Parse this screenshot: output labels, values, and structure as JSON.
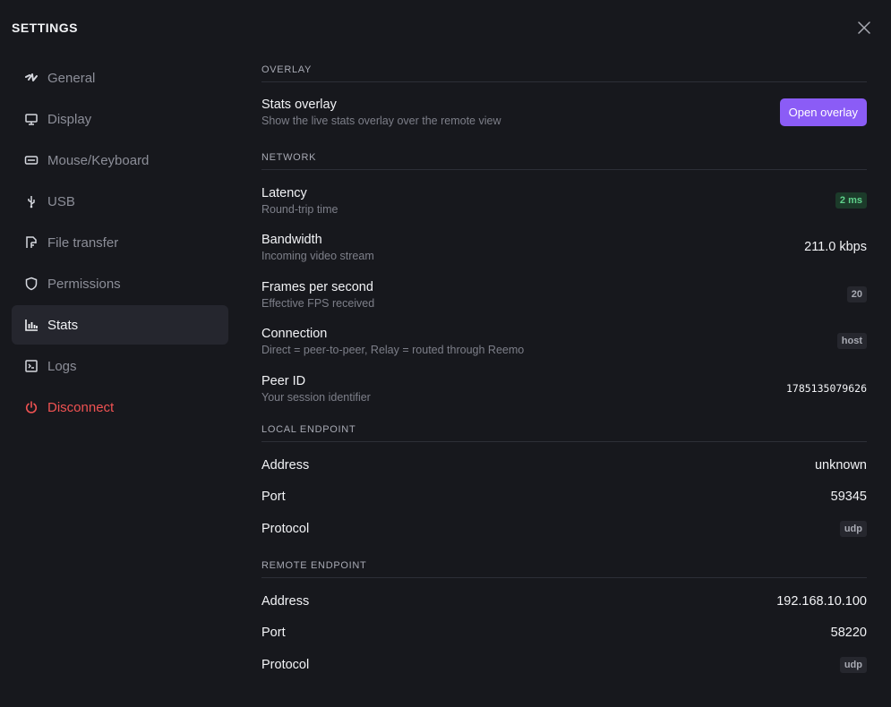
{
  "header": {
    "title": "SETTINGS",
    "close_icon": "close-icon"
  },
  "sidebar": {
    "items": [
      {
        "label": "General",
        "icon": "general-icon"
      },
      {
        "label": "Display",
        "icon": "monitor-icon"
      },
      {
        "label": "Mouse/Keyboard",
        "icon": "keyboard-icon"
      },
      {
        "label": "USB",
        "icon": "usb-icon"
      },
      {
        "label": "File transfer",
        "icon": "file-transfer-icon"
      },
      {
        "label": "Permissions",
        "icon": "shield-icon"
      },
      {
        "label": "Stats",
        "icon": "bar-chart-icon",
        "active": true
      },
      {
        "label": "Logs",
        "icon": "terminal-icon"
      },
      {
        "label": "Disconnect",
        "icon": "power-icon",
        "danger": true
      }
    ]
  },
  "overlay": {
    "section": "OVERLAY",
    "stats_overlay": {
      "label": "Stats overlay",
      "desc": "Show the live stats overlay over the remote view",
      "button": "Open overlay"
    }
  },
  "network": {
    "section": "NETWORK",
    "latency": {
      "label": "Latency",
      "desc": "Round-trip time",
      "value": "2 ms"
    },
    "bandwidth": {
      "label": "Bandwidth",
      "desc": "Incoming video stream",
      "value": "211.0 kbps"
    },
    "fps": {
      "label": "Frames per second",
      "desc": "Effective FPS received",
      "value": "20"
    },
    "connection": {
      "label": "Connection",
      "desc": "Direct = peer-to-peer, Relay = routed through Reemo",
      "value": "host"
    },
    "peer_id": {
      "label": "Peer ID",
      "desc": "Your session identifier",
      "value": "1785135079626"
    }
  },
  "local_endpoint": {
    "section": "LOCAL ENDPOINT",
    "address": {
      "label": "Address",
      "value": "unknown"
    },
    "port": {
      "label": "Port",
      "value": "59345"
    },
    "protocol": {
      "label": "Protocol",
      "value": "udp"
    }
  },
  "remote_endpoint": {
    "section": "REMOTE ENDPOINT",
    "address": {
      "label": "Address",
      "value": "192.168.10.100"
    },
    "port": {
      "label": "Port",
      "value": "58220"
    },
    "protocol": {
      "label": "Protocol",
      "value": "udp"
    }
  },
  "colors": {
    "accent": "#8b5cf6",
    "danger": "#f05252",
    "success": "#5fd18b",
    "background": "#17181d"
  }
}
